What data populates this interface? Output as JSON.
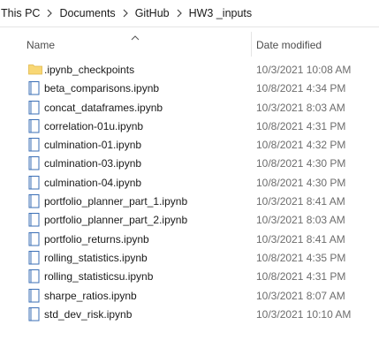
{
  "breadcrumb": [
    "This PC",
    "Documents",
    "GitHub",
    "HW3 _inputs"
  ],
  "columns": {
    "name": "Name",
    "date_modified": "Date modified"
  },
  "files": [
    {
      "name": ".ipynb_checkpoints",
      "date": "10/3/2021 10:08 AM",
      "type": "folder"
    },
    {
      "name": "beta_comparisons.ipynb",
      "date": "10/8/2021 4:34 PM",
      "type": "file"
    },
    {
      "name": "concat_dataframes.ipynb",
      "date": "10/3/2021 8:03 AM",
      "type": "file"
    },
    {
      "name": "correlation-01u.ipynb",
      "date": "10/8/2021 4:31 PM",
      "type": "file"
    },
    {
      "name": "culmination-01.ipynb",
      "date": "10/8/2021 4:32 PM",
      "type": "file"
    },
    {
      "name": "culmination-03.ipynb",
      "date": "10/8/2021 4:30 PM",
      "type": "file"
    },
    {
      "name": "culmination-04.ipynb",
      "date": "10/8/2021 4:30 PM",
      "type": "file"
    },
    {
      "name": "portfolio_planner_part_1.ipynb",
      "date": "10/3/2021 8:41 AM",
      "type": "file"
    },
    {
      "name": "portfolio_planner_part_2.ipynb",
      "date": "10/3/2021 8:03 AM",
      "type": "file"
    },
    {
      "name": "portfolio_returns.ipynb",
      "date": "10/3/2021 8:41 AM",
      "type": "file"
    },
    {
      "name": "rolling_statistics.ipynb",
      "date": "10/8/2021 4:35 PM",
      "type": "file"
    },
    {
      "name": "rolling_statisticsu.ipynb",
      "date": "10/8/2021 4:31 PM",
      "type": "file"
    },
    {
      "name": "sharpe_ratios.ipynb",
      "date": "10/3/2021 8:07 AM",
      "type": "file"
    },
    {
      "name": "std_dev_risk.ipynb",
      "date": "10/3/2021 10:10 AM",
      "type": "file"
    }
  ],
  "colors": {
    "folder": "#f8d775",
    "file_border": "#3b6fb6",
    "file_fill": "#ffffff"
  },
  "icons": {
    "folder": "folder-icon",
    "file": "notebook-file-icon",
    "separator": "chevron-right-icon",
    "sort": "sort-ascending-icon"
  }
}
